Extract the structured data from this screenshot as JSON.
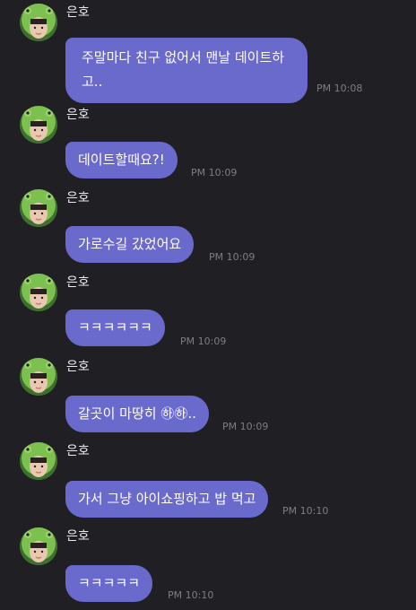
{
  "messages": [
    {
      "sender": "은호",
      "text": "주말마다 친구 없어서 맨날 데이트하고..",
      "time": "PM 10:08"
    },
    {
      "sender": "은호",
      "text": "데이트할때요?!",
      "time": "PM 10:09"
    },
    {
      "sender": "은호",
      "text": "가로수길 갔었어요",
      "time": "PM 10:09"
    },
    {
      "sender": "은호",
      "text": "ㅋㅋㅋㅋㅋㅋ",
      "time": "PM 10:09"
    },
    {
      "sender": "은호",
      "text": "갈곳이 마땅히 ㉻㉻..",
      "time": "PM 10:09"
    },
    {
      "sender": "은호",
      "text": "가서 그냥 아이쇼핑하고 밥 먹고",
      "time": "PM 10:10"
    },
    {
      "sender": "은호",
      "text": "ㅋㅋㅋㅋㅋ",
      "time": "PM 10:10"
    }
  ],
  "colors": {
    "background": "#1f1f24",
    "bubble": "#6a69cc",
    "timestamp": "#7d7d86",
    "sender": "#e9e9ee"
  }
}
